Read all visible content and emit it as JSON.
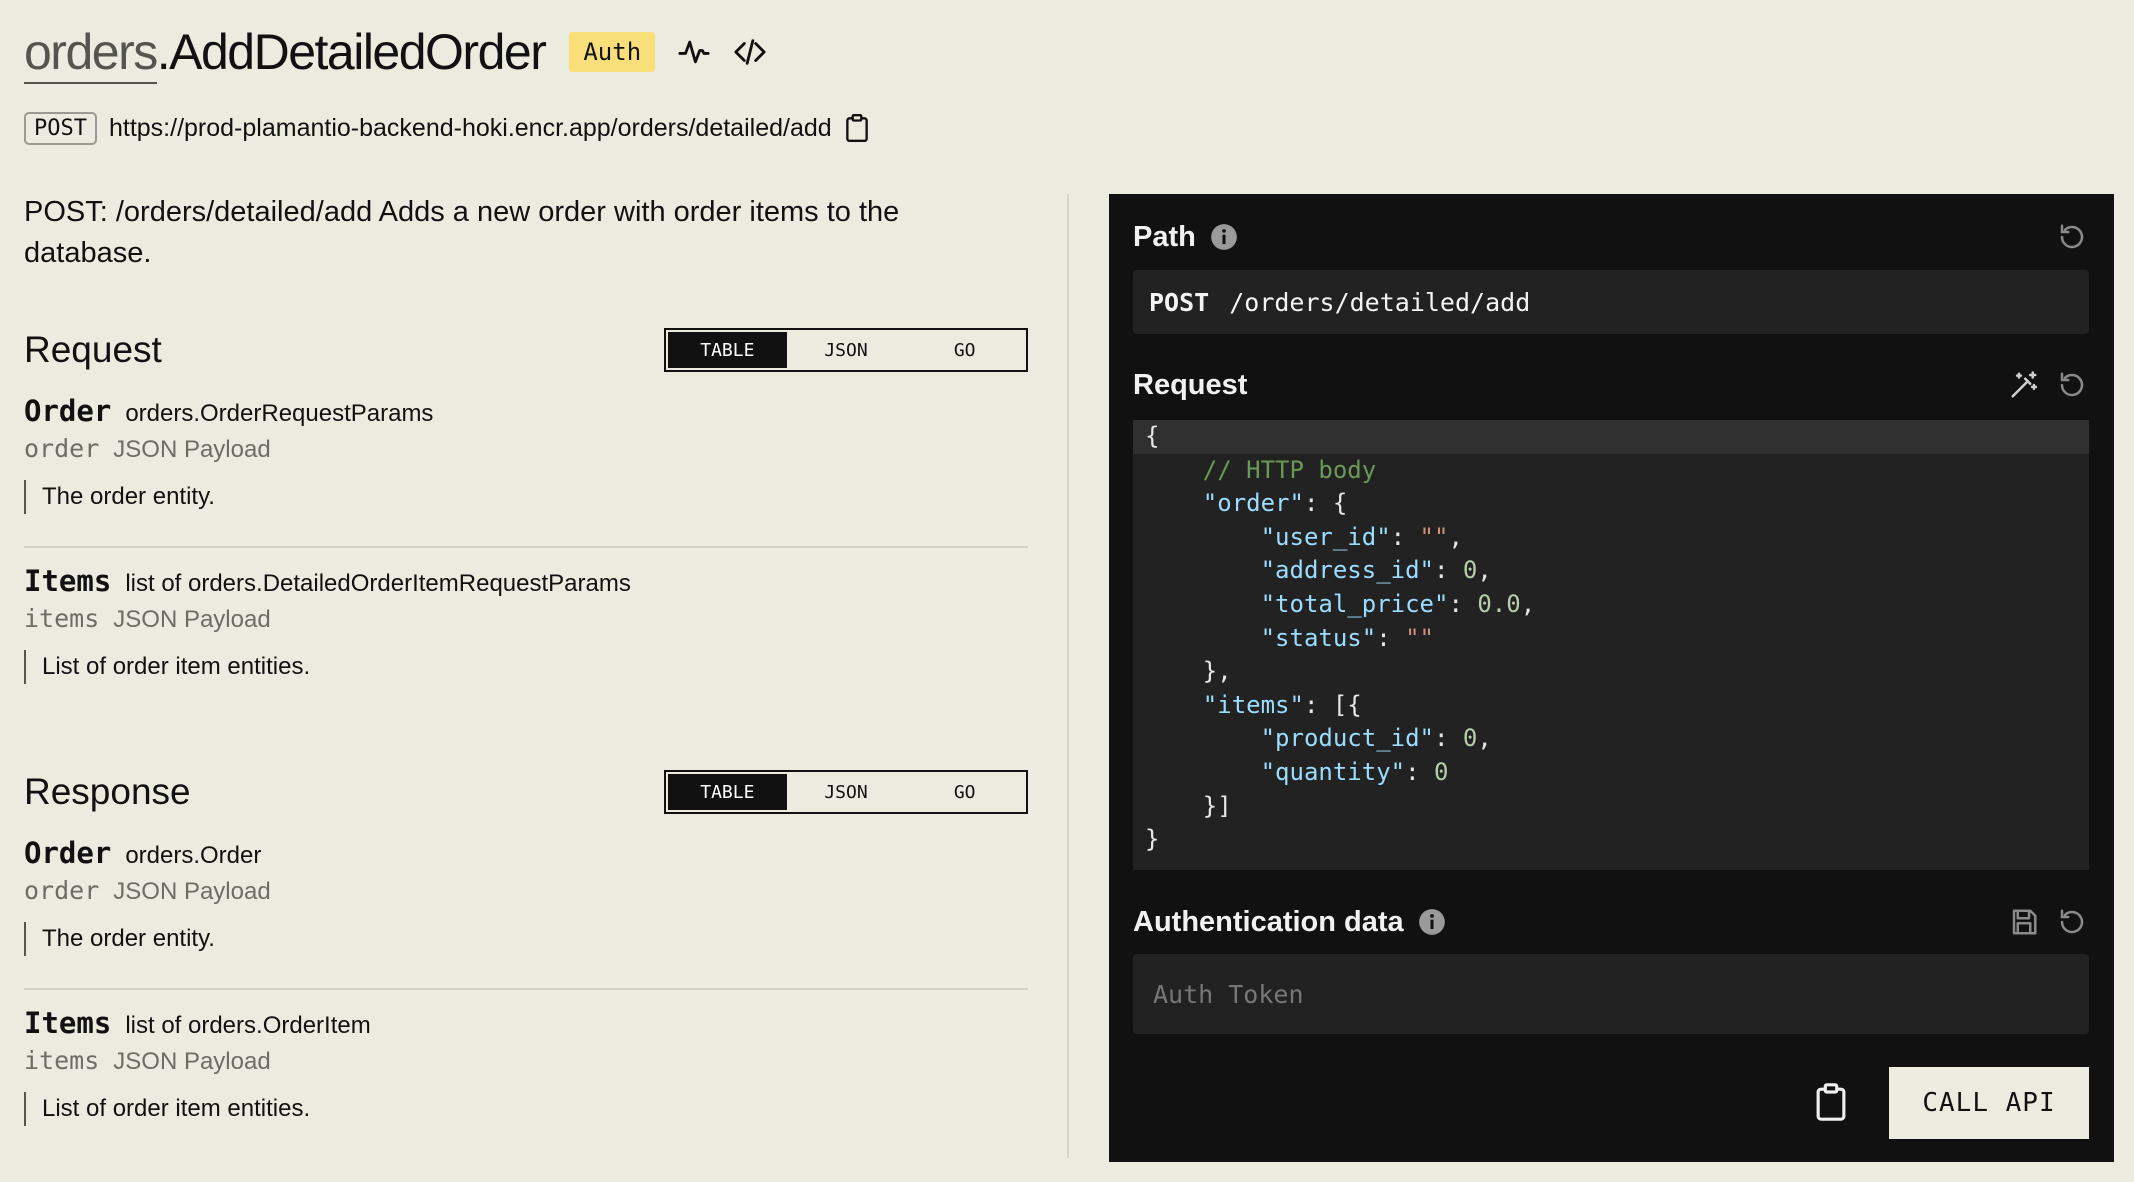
{
  "header": {
    "service": "orders",
    "endpoint": ".AddDetailedOrder",
    "auth_badge": "Auth",
    "method": "POST",
    "url": "https://prod-plamantio-backend-hoki.encr.app/orders/detailed/add"
  },
  "description": "POST: /orders/detailed/add Adds a new order with order items to the database.",
  "request": {
    "title": "Request",
    "toggle": [
      "TABLE",
      "JSON",
      "GO"
    ],
    "active": "TABLE",
    "fields": [
      {
        "name": "Order",
        "type": "orders.OrderRequestParams",
        "key": "order",
        "location": "JSON Payload",
        "desc": "The order entity."
      },
      {
        "name": "Items",
        "type": "list of orders.DetailedOrderItemRequestParams",
        "key": "items",
        "location": "JSON Payload",
        "desc": "List of order item entities."
      }
    ]
  },
  "response": {
    "title": "Response",
    "toggle": [
      "TABLE",
      "JSON",
      "GO"
    ],
    "active": "TABLE",
    "fields": [
      {
        "name": "Order",
        "type": "orders.Order",
        "key": "order",
        "location": "JSON Payload",
        "desc": "The order entity."
      },
      {
        "name": "Items",
        "type": "list of orders.OrderItem",
        "key": "items",
        "location": "JSON Payload",
        "desc": "List of order item entities."
      }
    ]
  },
  "panel": {
    "path_label": "Path",
    "path_method": "POST",
    "path_value": "/orders/detailed/add",
    "request_label": "Request",
    "request_body": [
      [
        [
          "p",
          "{"
        ]
      ],
      [
        [
          "p",
          "    "
        ],
        [
          "c",
          "// HTTP body"
        ]
      ],
      [
        [
          "p",
          "    "
        ],
        [
          "k",
          "\"order\""
        ],
        [
          "p",
          ": {"
        ]
      ],
      [
        [
          "p",
          "        "
        ],
        [
          "k",
          "\"user_id\""
        ],
        [
          "p",
          ": "
        ],
        [
          "s",
          "\"\""
        ],
        [
          "p",
          ","
        ]
      ],
      [
        [
          "p",
          "        "
        ],
        [
          "k",
          "\"address_id\""
        ],
        [
          "p",
          ": "
        ],
        [
          "n",
          "0"
        ],
        [
          "p",
          ","
        ]
      ],
      [
        [
          "p",
          "        "
        ],
        [
          "k",
          "\"total_price\""
        ],
        [
          "p",
          ": "
        ],
        [
          "n",
          "0.0"
        ],
        [
          "p",
          ","
        ]
      ],
      [
        [
          "p",
          "        "
        ],
        [
          "k",
          "\"status\""
        ],
        [
          "p",
          ": "
        ],
        [
          "s",
          "\"\""
        ]
      ],
      [
        [
          "p",
          "    },"
        ]
      ],
      [
        [
          "p",
          "    "
        ],
        [
          "k",
          "\"items\""
        ],
        [
          "p",
          ": [{"
        ]
      ],
      [
        [
          "p",
          "        "
        ],
        [
          "k",
          "\"product_id\""
        ],
        [
          "p",
          ": "
        ],
        [
          "n",
          "0"
        ],
        [
          "p",
          ","
        ]
      ],
      [
        [
          "p",
          "        "
        ],
        [
          "k",
          "\"quantity\""
        ],
        [
          "p",
          ": "
        ],
        [
          "n",
          "0"
        ]
      ],
      [
        [
          "p",
          "    }]"
        ]
      ],
      [
        [
          "p",
          "}"
        ]
      ]
    ],
    "auth_label": "Authentication data",
    "auth_placeholder": "Auth Token",
    "call_button": "CALL API"
  },
  "colors": {
    "background": "#ecebe0",
    "auth_badge": "#f9df7a",
    "panel": "#111111",
    "code_bg": "#222222",
    "comment": "#6a9955",
    "key": "#9cdcfe",
    "string": "#ce9178",
    "number": "#b5cea8"
  },
  "icons": [
    "activity-icon",
    "code-icon",
    "clipboard-icon",
    "info-icon",
    "reset-icon",
    "magic-wand-icon",
    "save-icon"
  ]
}
